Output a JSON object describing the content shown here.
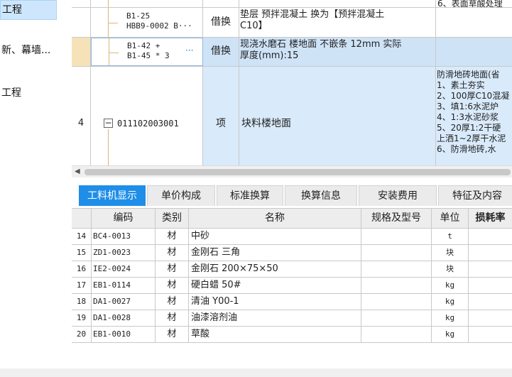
{
  "sidebar": {
    "items": [
      {
        "label": "工程",
        "active": true
      },
      {
        "label": "新、幕墙...",
        "active": false
      },
      {
        "label": "工程",
        "active": false
      }
    ]
  },
  "upper_grid": {
    "top_partial_text": "6、表面草酸处理",
    "rows": [
      {
        "code_line1": "B1-25",
        "code_line2": "HBB9-0002 B···",
        "type": "借换",
        "desc_line1": "垫层 预拌混凝土  换为【预拌混凝土",
        "desc_line2": "C10】",
        "selected": false
      },
      {
        "code_line1": "B1-42 +",
        "code_line2": "B1-45 * 3",
        "code_ellipsis": "···",
        "type": "借换",
        "desc_line1": "现浇水磨石 楼地面 不嵌条 12mm  实际",
        "desc_line2": "厚度(mm):15",
        "selected": true
      },
      {
        "row_number": "4",
        "collapse_symbol": "−",
        "code": "011102003001",
        "type": "项",
        "name": "块料楼地面",
        "features": [
          "防滑地砖地面(省",
          "1、素土夯实",
          "2、100厚C10混凝",
          "3、填1:6水泥炉",
          "4、1:3水泥砂浆",
          "5、20厚1:2干硬",
          "上洒1~2厚干水泥",
          "6、防滑地砖,水"
        ]
      }
    ]
  },
  "scrollbar": {
    "left_arrow": "◀"
  },
  "tabs": [
    {
      "label": "工料机显示",
      "active": true
    },
    {
      "label": "单价构成",
      "active": false
    },
    {
      "label": "标准换算",
      "active": false
    },
    {
      "label": "换算信息",
      "active": false
    },
    {
      "label": "安装费用",
      "active": false
    },
    {
      "label": "特征及内容",
      "active": false
    }
  ],
  "material_table": {
    "headers": {
      "index": "",
      "code": "编码",
      "category": "类别",
      "name": "名称",
      "spec": "规格及型号",
      "unit": "单位",
      "loss": "损耗率"
    },
    "rows": [
      {
        "index": "14",
        "code": "BC4-0013",
        "category": "材",
        "name": "中砂",
        "spec": "",
        "unit": "t",
        "loss": ""
      },
      {
        "index": "15",
        "code": "ZD1-0023",
        "category": "材",
        "name": "金刚石 三角",
        "spec": "",
        "unit": "块",
        "loss": ""
      },
      {
        "index": "16",
        "code": "IE2-0024",
        "category": "材",
        "name": "金刚石 200×75×50",
        "spec": "",
        "unit": "块",
        "loss": ""
      },
      {
        "index": "17",
        "code": "EB1-0114",
        "category": "材",
        "name": "硬白蜡 50#",
        "spec": "",
        "unit": "kg",
        "loss": ""
      },
      {
        "index": "18",
        "code": "DA1-0027",
        "category": "材",
        "name": "清油 Y00-1",
        "spec": "",
        "unit": "kg",
        "loss": ""
      },
      {
        "index": "19",
        "code": "DA1-0028",
        "category": "材",
        "name": "油漆溶剂油",
        "spec": "",
        "unit": "kg",
        "loss": ""
      },
      {
        "index": "20",
        "code": "EB1-0010",
        "category": "材",
        "name": "草酸",
        "spec": "",
        "unit": "kg",
        "loss": ""
      }
    ]
  },
  "colors": {
    "tab_active": "#1f8ee8",
    "selected_row": "#cfe3f7",
    "sidebar_active": "#cde6fb"
  }
}
